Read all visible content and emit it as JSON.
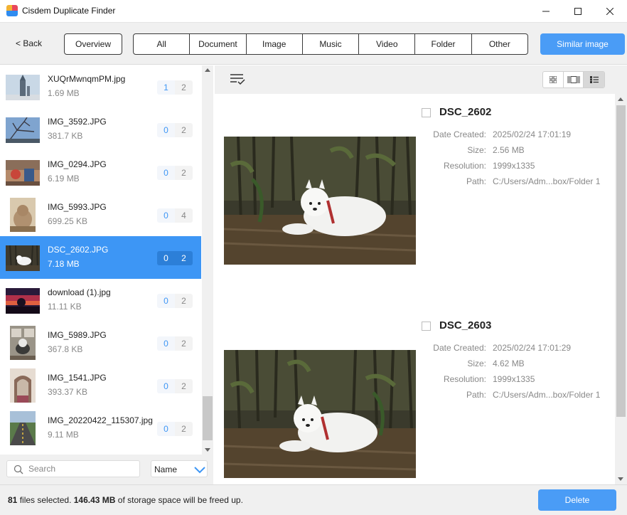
{
  "window": {
    "title": "Cisdem Duplicate Finder",
    "icons": [
      "app-icon",
      "minimize-icon",
      "maximize-icon",
      "close-icon"
    ]
  },
  "toolbar": {
    "back_label": "< Back",
    "overview_label": "Overview",
    "tabs": [
      "All",
      "Document",
      "Image",
      "Music",
      "Video",
      "Folder",
      "Other"
    ],
    "similar_label": "Similar image"
  },
  "list": {
    "items": [
      {
        "name": "XUQrMwnqmPM.jpg",
        "size": "1.69 MB",
        "selected_count": "1",
        "total_count": "2"
      },
      {
        "name": "IMG_3592.JPG",
        "size": "381.7 KB",
        "selected_count": "0",
        "total_count": "2"
      },
      {
        "name": "IMG_0294.JPG",
        "size": "6.19 MB",
        "selected_count": "0",
        "total_count": "2"
      },
      {
        "name": "IMG_5993.JPG",
        "size": "699.25 KB",
        "selected_count": "0",
        "total_count": "4"
      },
      {
        "name": "DSC_2602.JPG",
        "size": "7.18 MB",
        "selected_count": "0",
        "total_count": "2"
      },
      {
        "name": "download (1).jpg",
        "size": "11.11 KB",
        "selected_count": "0",
        "total_count": "2"
      },
      {
        "name": "IMG_5989.JPG",
        "size": "367.8 KB",
        "selected_count": "0",
        "total_count": "2"
      },
      {
        "name": "IMG_1541.JPG",
        "size": "393.37 KB",
        "selected_count": "0",
        "total_count": "2"
      },
      {
        "name": "IMG_20220422_115307.jpg",
        "size": "9.11 MB",
        "selected_count": "0",
        "total_count": "2"
      }
    ]
  },
  "search": {
    "placeholder": "Search",
    "sort_value": "Name"
  },
  "details": {
    "labels": {
      "date": "Date Created:",
      "size": "Size:",
      "resolution": "Resolution:",
      "path": "Path:"
    },
    "files": [
      {
        "title": "DSC_2602",
        "date": "2025/02/24 17:01:19",
        "size": "2.56 MB",
        "resolution": "1999x1335",
        "path": "C:/Users/Adm...box/Folder 1"
      },
      {
        "title": "DSC_2603",
        "date": "2025/02/24 17:01:29",
        "size": "4.62 MB",
        "resolution": "1999x1335",
        "path": "C:/Users/Adm...box/Folder 1"
      }
    ]
  },
  "footer": {
    "files_count": "81",
    "files_text": "files selected.",
    "space": "146.43 MB",
    "space_text": "of storage space will be freed up.",
    "delete_label": "Delete"
  },
  "colors": {
    "accent": "#4a9cf6",
    "selected_row": "#3d96f5"
  }
}
